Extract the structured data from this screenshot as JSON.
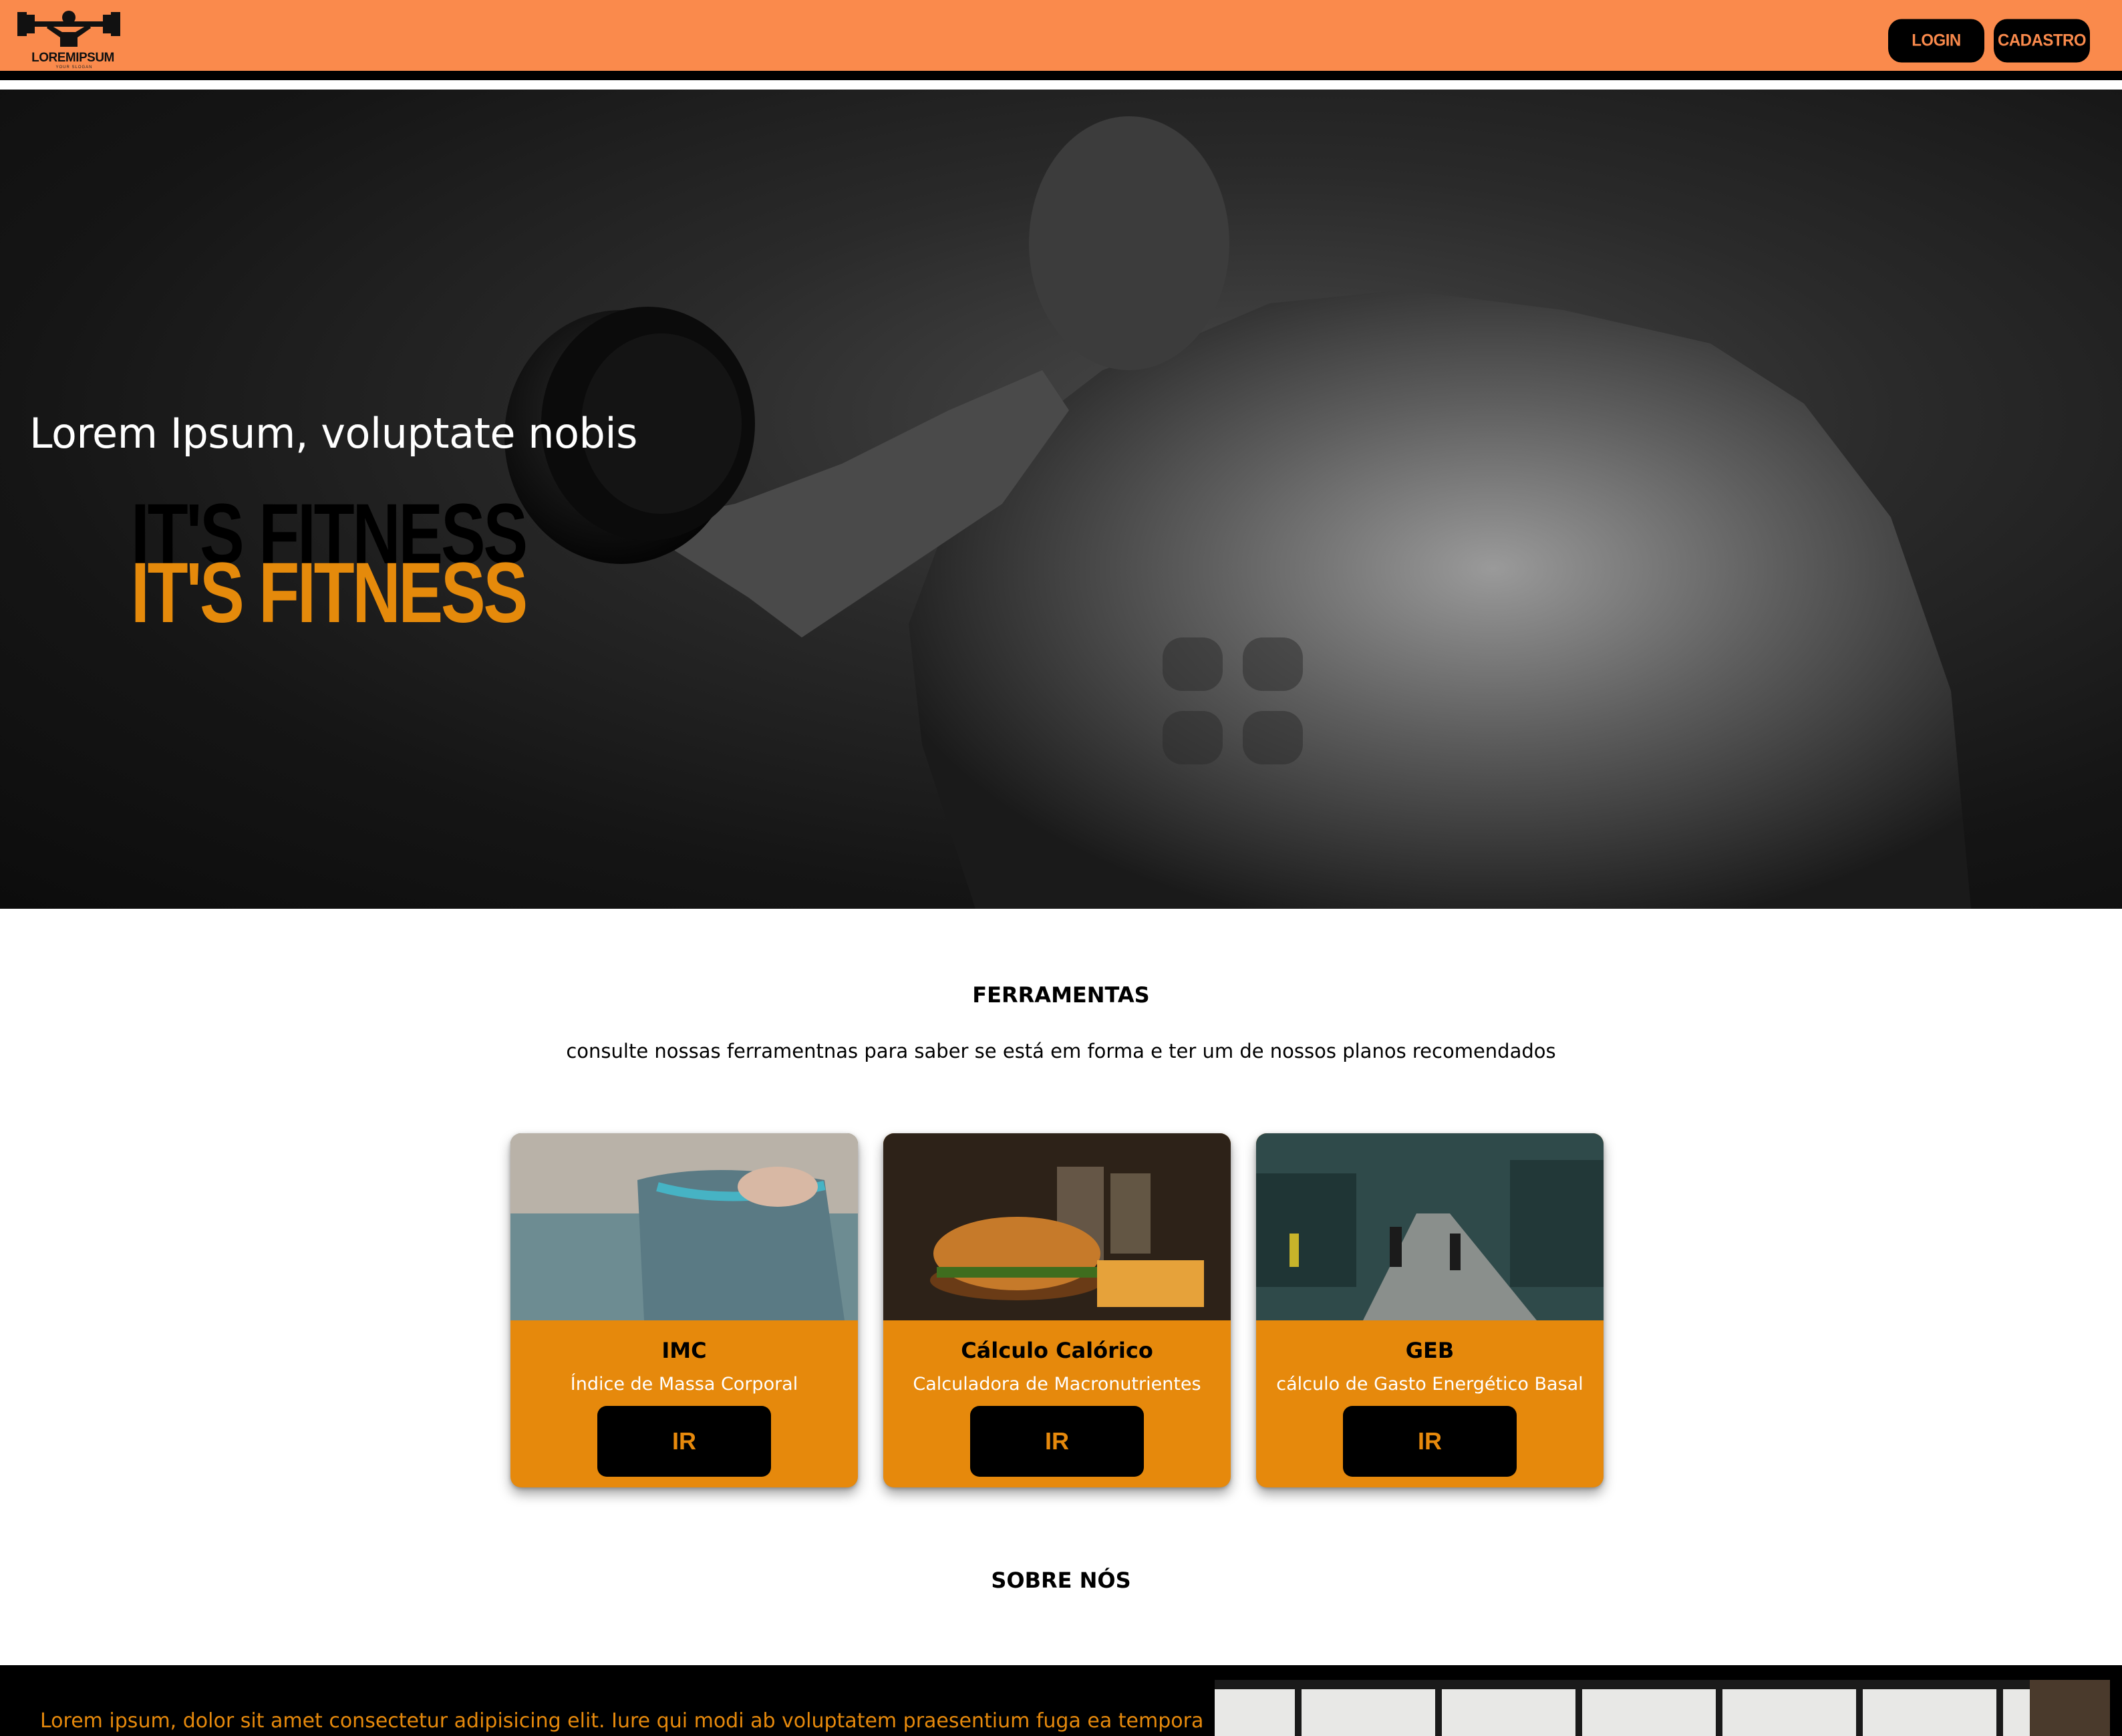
{
  "header": {
    "logo_text": "LOREMIPSUM",
    "logo_slogan": "YOUR SLOGAN",
    "login_label": "LOGIN",
    "signup_label": "CADASTRO"
  },
  "hero": {
    "subtitle": "Lorem Ipsum, voluptate nobis",
    "title_back": "IT'S FITNESS",
    "title_front": "IT'S FITNESS"
  },
  "tools": {
    "title": "FERRAMENTAS",
    "description": "consulte nossas ferramentnas para saber se está em forma e ter um de nossos planos recomendados",
    "cards": [
      {
        "title": "IMC",
        "subtitle": "Índice de Massa Corporal",
        "button": "IR"
      },
      {
        "title": "Cálculo Calórico",
        "subtitle": "Calculadora de Macronutrientes",
        "button": "IR"
      },
      {
        "title": "GEB",
        "subtitle": "cálculo de Gasto Energético Basal",
        "button": "IR"
      }
    ]
  },
  "about": {
    "title": "SOBRE NÓS",
    "text": "Lorem ipsum, dolor sit amet consectetur adipisicing elit. Iure qui modi ab voluptatem praesentium fuga ea tempora"
  },
  "colors": {
    "header_bg": "#fa8a4c",
    "accent": "#e6890c",
    "dark": "#000000"
  },
  "icons": {
    "logo": "weightlifter-barbell-icon"
  }
}
